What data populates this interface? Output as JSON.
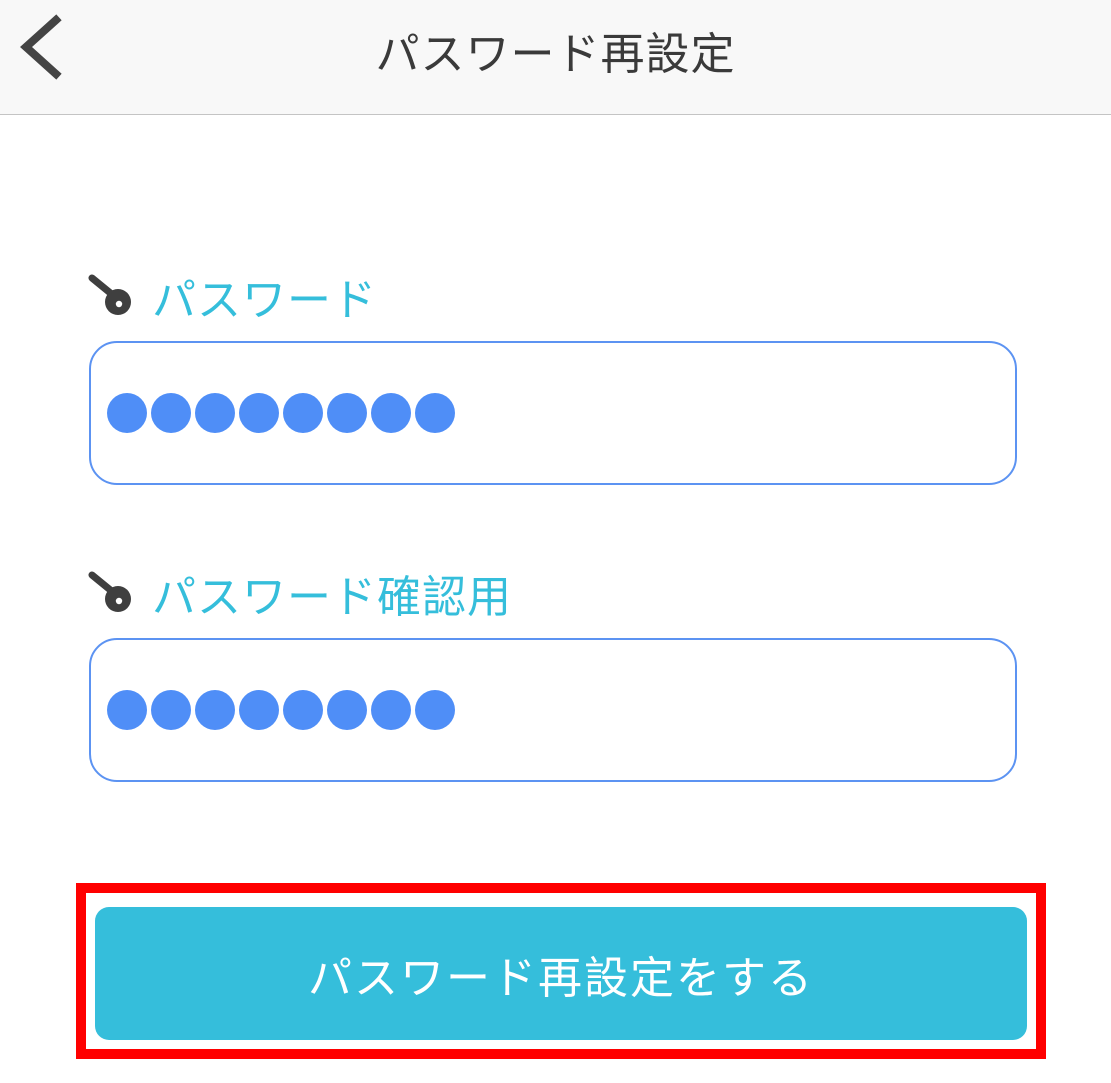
{
  "header": {
    "title": "パスワード再設定",
    "back_icon": "chevron-left-icon"
  },
  "form": {
    "password": {
      "label": "パスワード",
      "icon": "key-icon",
      "masked_char_count": 8
    },
    "password_confirm": {
      "label": "パスワード確認用",
      "icon": "key-icon",
      "masked_char_count": 8
    },
    "submit_label": "パスワード再設定をする"
  },
  "colors": {
    "accent": "#35bedb",
    "input_border": "#5c93f2",
    "mask_dot": "#4f8ef7",
    "highlight": "#ff0000"
  }
}
